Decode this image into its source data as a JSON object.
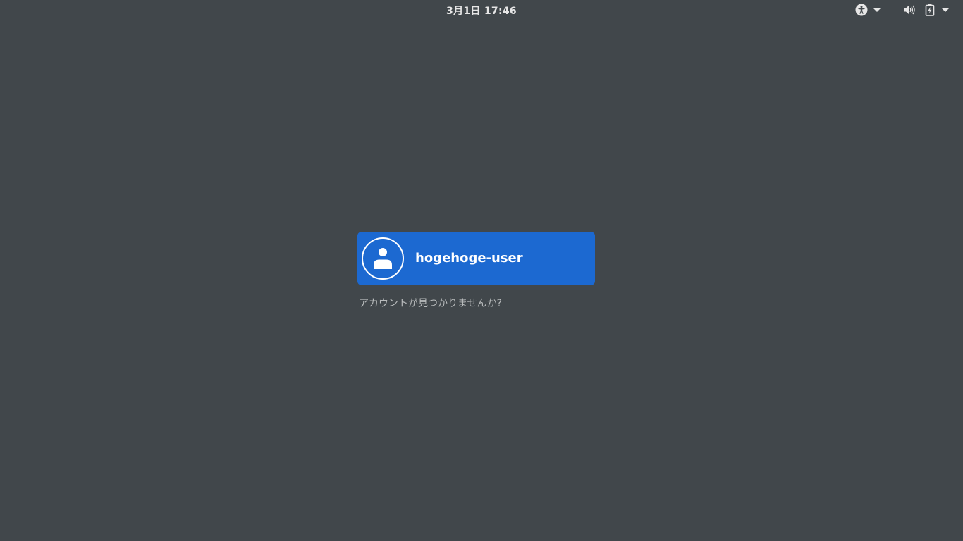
{
  "topbar": {
    "clock": "3月1日  17:46",
    "icons": {
      "accessibility": "accessibility-icon",
      "volume": "volume-icon",
      "battery": "battery-charging-icon",
      "menu_caret": "chevron-down-icon"
    }
  },
  "login": {
    "user": {
      "name": "hogehoge-user",
      "avatar_icon": "user-avatar-icon"
    },
    "not_listed_label": "アカウントが見つかりませんか?"
  },
  "colors": {
    "background": "#41474b",
    "user_card": "#1c69d1",
    "text_primary": "#ffffff",
    "text_secondary": "#b9bcbd"
  }
}
